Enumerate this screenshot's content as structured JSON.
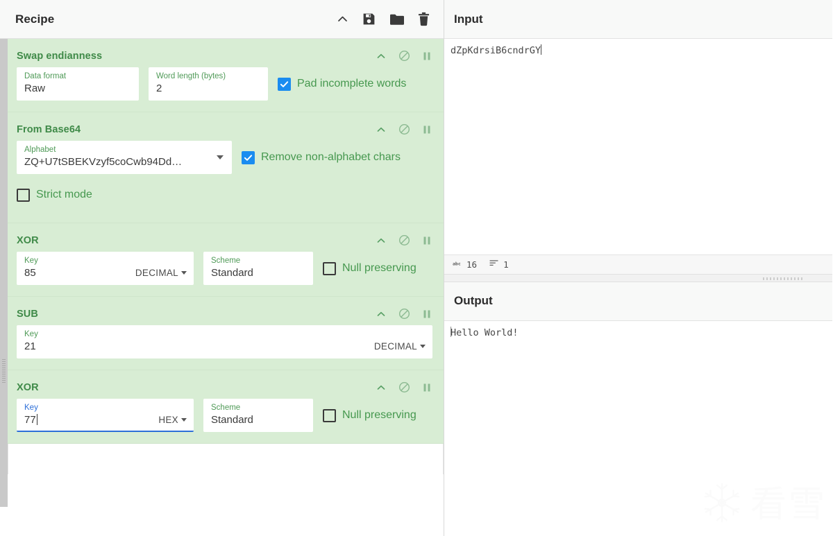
{
  "recipe": {
    "title": "Recipe",
    "actions": [
      {
        "name": "collapse-icon",
        "label": "Collapse"
      },
      {
        "name": "save-icon",
        "label": "Save recipe"
      },
      {
        "name": "folder-icon",
        "label": "Load recipe"
      },
      {
        "name": "trash-icon",
        "label": "Clear recipe"
      }
    ],
    "op_icons": [
      {
        "name": "chevron-up-icon",
        "label": "Collapse operation"
      },
      {
        "name": "disable-icon",
        "label": "Disable operation"
      },
      {
        "name": "pause-icon",
        "label": "Set breakpoint"
      }
    ],
    "operations": [
      {
        "name": "Swap endianness",
        "fields": [
          {
            "type": "text",
            "label": "Data format",
            "value": "Raw"
          },
          {
            "type": "text",
            "label": "Word length (bytes)",
            "value": "2"
          }
        ],
        "checkboxes": [
          {
            "label": "Pad incomplete words",
            "checked": true
          }
        ]
      },
      {
        "name": "From Base64",
        "fields": [
          {
            "type": "select",
            "label": "Alphabet",
            "value": "ZQ+U7tSBEKVzyf5coCwb94Dd…"
          }
        ],
        "checkboxes": [
          {
            "label": "Remove non-alphabet chars",
            "checked": true
          },
          {
            "label": "Strict mode",
            "checked": false
          }
        ]
      },
      {
        "name": "XOR",
        "fields": [
          {
            "type": "text",
            "label": "Key",
            "value": "85",
            "unit": "DECIMAL"
          },
          {
            "type": "text",
            "label": "Scheme",
            "value": "Standard"
          }
        ],
        "checkboxes": [
          {
            "label": "Null preserving",
            "checked": false
          }
        ]
      },
      {
        "name": "SUB",
        "fields": [
          {
            "type": "text",
            "label": "Key",
            "value": "21",
            "unit": "DECIMAL"
          }
        ],
        "checkboxes": []
      },
      {
        "name": "XOR",
        "fields": [
          {
            "type": "text",
            "label": "Key",
            "value": "77",
            "unit": "HEX",
            "focused": true
          },
          {
            "type": "text",
            "label": "Scheme",
            "value": "Standard"
          }
        ],
        "checkboxes": [
          {
            "label": "Null preserving",
            "checked": false
          }
        ]
      }
    ]
  },
  "input": {
    "title": "Input",
    "value": "dZpKdrsiB6cndrGY",
    "status": {
      "length_icon": "abc-icon",
      "length": "16",
      "lines_icon": "lines-icon",
      "lines": "1"
    }
  },
  "output": {
    "title": "Output",
    "value": "Hello World!"
  },
  "watermark": {
    "icon": "snowflake-icon",
    "text": "看雪"
  },
  "colors": {
    "op_background": "#d8edd4",
    "op_title": "#3f8a48",
    "checkbox_on": "#1a8cf0",
    "focus_underline": "#2d6fd8",
    "field_label": "#4f9a57"
  }
}
